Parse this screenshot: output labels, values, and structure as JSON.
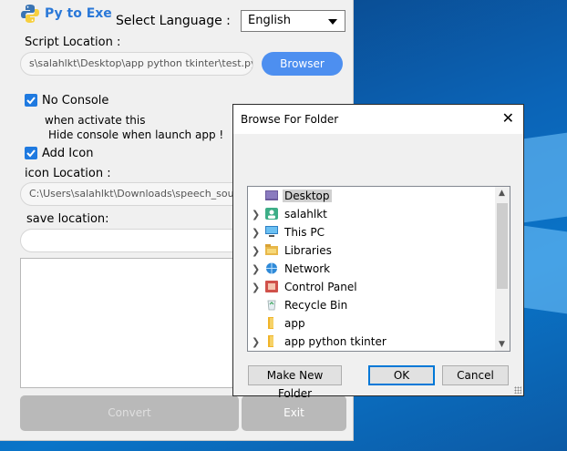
{
  "app": {
    "title": "Py to Exe",
    "language_label": "Select Language :",
    "language_value": "English",
    "script_location_label": "Script Location :",
    "script_path": "s\\salahlkt\\Desktop\\app python tkinter\\test.py",
    "browse_label": "Browser",
    "no_console_label": "No Console",
    "no_console_checked": true,
    "no_console_note_1": "when activate this",
    "no_console_note_2": "Hide console when launch app !",
    "add_icon_label": "Add Icon",
    "add_icon_checked": true,
    "icon_location_label": "icon Location :",
    "icon_path": "C:\\Users\\salahlkt\\Downloads\\speech_sour",
    "save_location_label": "save location:",
    "save_path": "",
    "convert_label": "Convert",
    "exit_label": "Exit"
  },
  "dialog": {
    "title": "Browse For Folder",
    "close_glyph": "✕",
    "tree": [
      {
        "label": "Desktop",
        "icon": "desktop-icon",
        "expandable": false,
        "selected": true
      },
      {
        "label": "salahlkt",
        "icon": "user-folder-icon",
        "expandable": true
      },
      {
        "label": "This PC",
        "icon": "computer-icon",
        "expandable": true
      },
      {
        "label": "Libraries",
        "icon": "libraries-icon",
        "expandable": true
      },
      {
        "label": "Network",
        "icon": "network-icon",
        "expandable": true
      },
      {
        "label": "Control Panel",
        "icon": "control-panel-icon",
        "expandable": true
      },
      {
        "label": "Recycle Bin",
        "icon": "recycle-bin-icon",
        "expandable": false
      },
      {
        "label": "app",
        "icon": "folder-icon",
        "expandable": false
      },
      {
        "label": "app python tkinter",
        "icon": "folder-icon",
        "expandable": true
      }
    ],
    "make_new_folder_label": "Make New Folder",
    "ok_label": "OK",
    "cancel_label": "Cancel"
  },
  "colors": {
    "accent": "#4d8ff0",
    "title_blue": "#2a78d8",
    "checkbox": "#1f7ae0",
    "disabled_button": "#b9b9b9"
  }
}
